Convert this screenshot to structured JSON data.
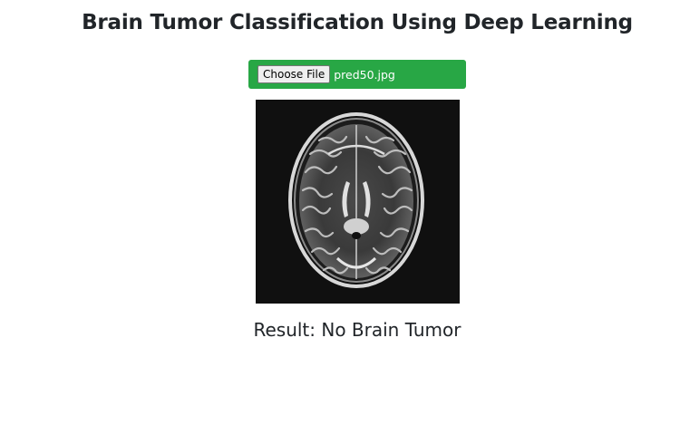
{
  "page": {
    "title": "Brain Tumor Classification Using Deep Learning"
  },
  "upload": {
    "button_label": "Choose File",
    "file_name": "pred50.jpg",
    "bar_color": "#28a745"
  },
  "preview": {
    "icon": "mri-scan-image"
  },
  "result": {
    "label": "Result:",
    "value": "No Brain Tumor",
    "text": "Result: No Brain Tumor"
  }
}
